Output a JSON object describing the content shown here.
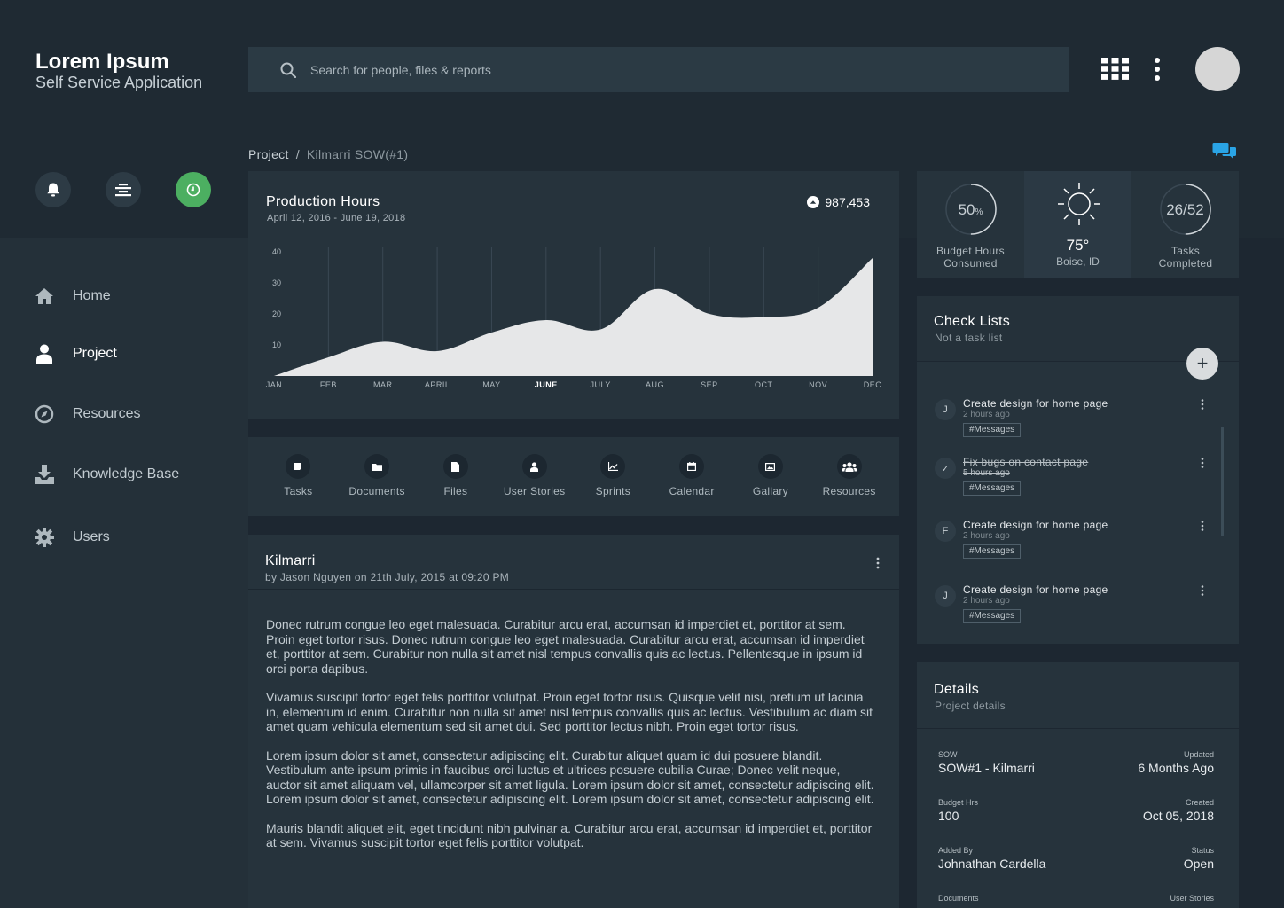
{
  "brand": {
    "title": "Lorem Ipsum",
    "subtitle": "Self Service Application"
  },
  "search": {
    "placeholder": "Search for people, files & reports"
  },
  "header_icons": [
    "apps-grid-icon",
    "more-vertical-icon",
    "avatar"
  ],
  "quick_buttons": [
    "bell-icon",
    "align-center-icon",
    "clock-icon"
  ],
  "sidebar": {
    "items": [
      {
        "label": "Home",
        "icon": "home-icon",
        "active": false
      },
      {
        "label": "Project",
        "icon": "user-icon",
        "active": true
      },
      {
        "label": "Resources",
        "icon": "compass-icon",
        "active": false
      },
      {
        "label": "Knowledge Base",
        "icon": "download-icon",
        "active": false
      },
      {
        "label": "Users",
        "icon": "gear-icon",
        "active": false
      }
    ]
  },
  "breadcrumb": {
    "root": "Project",
    "separator": "/",
    "current": "Kilmarri SOW(#1)"
  },
  "production": {
    "title": "Production Hours",
    "date_range": "April 12, 2016 - June 19, 2018",
    "total": "987,453"
  },
  "chart_data": {
    "type": "area",
    "title": "Production Hours",
    "categories": [
      "JAN",
      "FEB",
      "MAR",
      "APRIL",
      "MAY",
      "JUNE",
      "JULY",
      "AUG",
      "SEP",
      "OCT",
      "NOV",
      "DEC"
    ],
    "highlighted_category": "JUNE",
    "series": [
      {
        "values": [
          0,
          6,
          11,
          8,
          14,
          18,
          15,
          28,
          20,
          19,
          22,
          38
        ]
      }
    ],
    "y_ticks": [
      10,
      20,
      30,
      40
    ],
    "ylim": [
      0,
      40
    ],
    "grid": "vertical"
  },
  "tools": [
    {
      "label": "Tasks",
      "icon": "task-icon"
    },
    {
      "label": "Documents",
      "icon": "folder-icon"
    },
    {
      "label": "Files",
      "icon": "file-icon"
    },
    {
      "label": "User Stories",
      "icon": "person-icon"
    },
    {
      "label": "Sprints",
      "icon": "chart-line-icon"
    },
    {
      "label": "Calendar",
      "icon": "calendar-icon"
    },
    {
      "label": "Gallary",
      "icon": "image-icon"
    },
    {
      "label": "Resources",
      "icon": "group-icon"
    }
  ],
  "article": {
    "title": "Kilmarri",
    "byline": "by Jason Nguyen on 21th July, 2015 at 09:20 PM",
    "paragraphs": [
      "Donec rutrum congue leo eget malesuada. Curabitur arcu erat, accumsan id imperdiet et, porttitor at sem. Proin eget tortor risus. Donec rutrum congue leo eget malesuada. Curabitur arcu erat, accumsan id imperdiet et, porttitor at sem. Curabitur non nulla sit amet nisl tempus convallis quis ac lectus. Pellentesque in ipsum id orci porta dapibus.",
      "Vivamus suscipit tortor eget felis porttitor volutpat. Proin eget tortor risus. Quisque velit nisi, pretium ut lacinia in, elementum id enim. Curabitur non nulla sit amet nisl tempus convallis quis ac lectus. Vestibulum ac diam sit amet quam vehicula elementum sed sit amet dui. Sed porttitor lectus nibh. Proin eget tortor risus.",
      "Lorem ipsum dolor sit amet, consectetur adipiscing elit. Curabitur aliquet quam id dui posuere blandit. Vestibulum ante ipsum primis in faucibus orci luctus et ultrices posuere cubilia Curae; Donec velit neque, auctor sit amet aliquam vel, ullamcorper sit amet ligula. Lorem ipsum dolor sit amet, consectetur adipiscing elit. Lorem ipsum dolor sit amet, consectetur adipiscing elit. Lorem ipsum dolor sit amet, consectetur adipiscing elit.",
      "Mauris blandit aliquet elit, eget tincidunt nibh pulvinar a. Curabitur arcu erat, accumsan id imperdiet et, porttitor at sem. Vivamus suscipit tortor eget felis porttitor volutpat."
    ]
  },
  "stats": {
    "budget": {
      "value": "50",
      "unit": "%",
      "label_line1": "Budget Hours",
      "label_line2": "Consumed",
      "fraction": 0.5
    },
    "weather": {
      "temp": "75°",
      "location": "Boise, ID",
      "icon": "sun-icon"
    },
    "tasks": {
      "value": "26/52",
      "label": "Tasks Completed",
      "fraction": 0.5
    }
  },
  "checklists": {
    "title": "Check Lists",
    "subtitle": "Not a task list",
    "add_label": "+",
    "items": [
      {
        "avatar": "J",
        "title": "Create design for home page",
        "time": "2 hours ago",
        "tag": "#Messages",
        "done": false
      },
      {
        "avatar": "✓",
        "title": "Fix bugs on contact page",
        "time": "5 hours ago",
        "tag": "#Messages",
        "done": true
      },
      {
        "avatar": "F",
        "title": "Create design for home page",
        "time": "2 hours ago",
        "tag": "#Messages",
        "done": false
      },
      {
        "avatar": "J",
        "title": "Create design for home page",
        "time": "2 hours ago",
        "tag": "#Messages",
        "done": false
      }
    ]
  },
  "details": {
    "title": "Details",
    "subtitle": "Project details",
    "rows": [
      {
        "lk": "SOW",
        "lv": "SOW#1 - Kilmarri",
        "rk": "Updated",
        "rv": "6 Months Ago"
      },
      {
        "lk": "Budget Hrs",
        "lv": "100",
        "rk": "Created",
        "rv": "Oct 05, 2018"
      },
      {
        "lk": "Added By",
        "lv": "Johnathan Cardella",
        "rk": "Status",
        "rv": "Open"
      },
      {
        "lk": "Documents",
        "lv": "",
        "rk": "User Stories",
        "rv": ""
      }
    ]
  },
  "colors": {
    "background": "#1d2731",
    "panel": "#26333c",
    "accent_green": "#4caf61",
    "chat_blue": "#2aa4e6"
  }
}
